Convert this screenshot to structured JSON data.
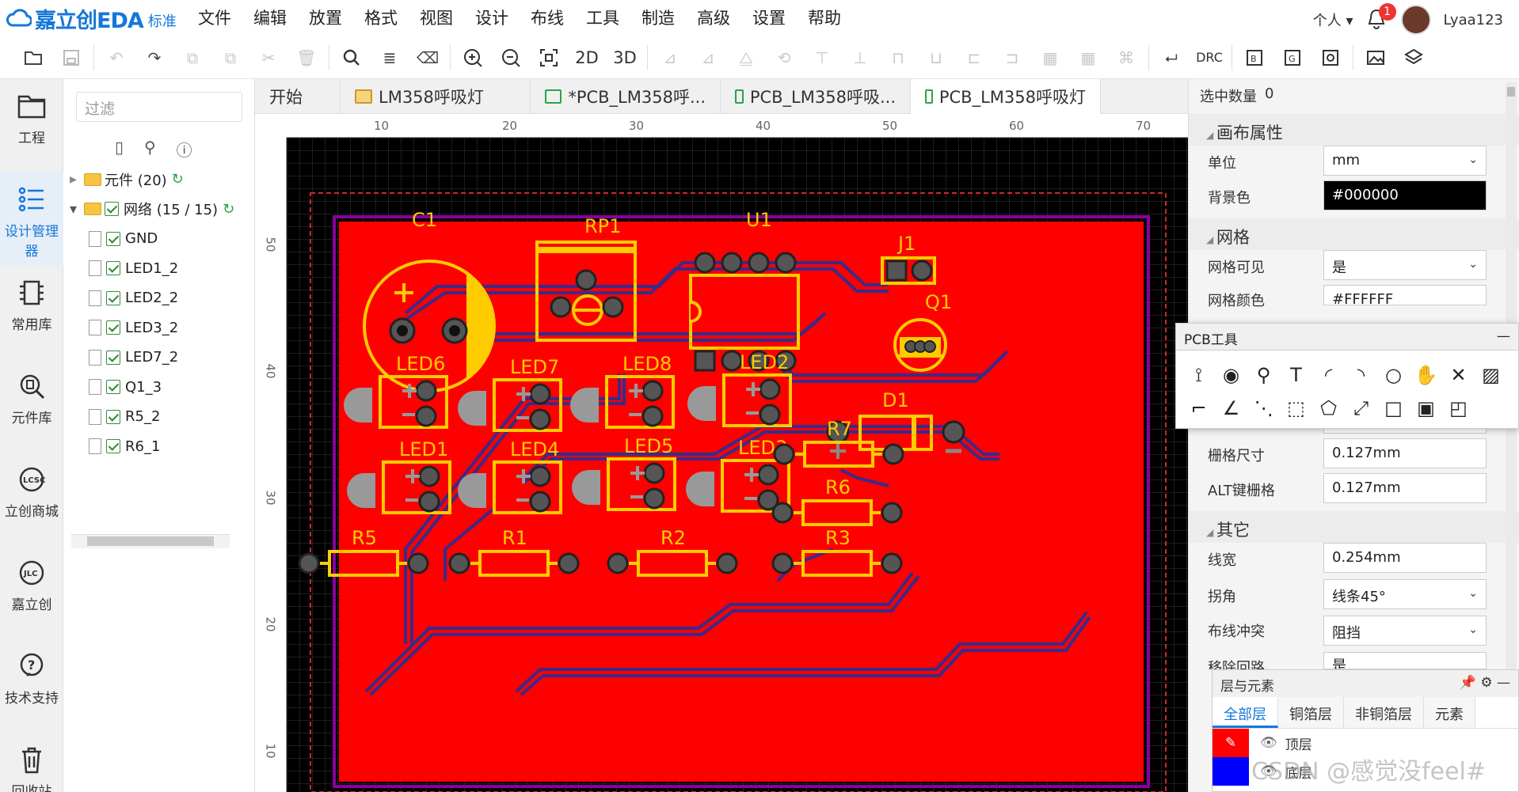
{
  "app": {
    "logo_text": "嘉立创EDA",
    "edition": "标准"
  },
  "menu": [
    "文件",
    "编辑",
    "放置",
    "格式",
    "视图",
    "设计",
    "布线",
    "工具",
    "制造",
    "高级",
    "设置",
    "帮助"
  ],
  "user": {
    "scope": "个人",
    "notifications": "1",
    "name": "Lyaa123"
  },
  "toolbar": {
    "btn_2d": "2D",
    "btn_3d": "3D",
    "btn_drc": "DRC"
  },
  "leftnav": [
    {
      "label": "工程",
      "icon": "folder-icon"
    },
    {
      "label": "设计管理器",
      "icon": "list-icon"
    },
    {
      "label": "常用库",
      "icon": "chip-icon"
    },
    {
      "label": "元件库",
      "icon": "search-chip-icon"
    },
    {
      "label": "立创商城",
      "icon": "lcsc-icon"
    },
    {
      "label": "嘉立创",
      "icon": "jlc-icon"
    },
    {
      "label": "技术支持",
      "icon": "help-icon"
    },
    {
      "label": "回收站",
      "icon": "trash-icon"
    }
  ],
  "tree": {
    "filter_placeholder": "过滤",
    "components": "元件 (20)",
    "nets": "网络 (15 / 15)",
    "net_items": [
      "GND",
      "LED1_2",
      "LED2_2",
      "LED3_2",
      "LED7_2",
      "Q1_3",
      "R5_2",
      "R6_1"
    ]
  },
  "tabs": [
    "开始",
    "LM358呼吸灯",
    "*PCB_LM358呼...",
    "PCB_LM358呼吸...",
    "PCB_LM358呼吸灯"
  ],
  "ruler": {
    "top": [
      "10",
      "20",
      "30",
      "40",
      "50",
      "60",
      "70"
    ],
    "left": [
      "50",
      "40",
      "30",
      "20",
      "10"
    ]
  },
  "pcb": {
    "components": [
      "C1",
      "RP1",
      "U1",
      "J1",
      "Q1",
      "D1",
      "LED6",
      "LED7",
      "LED8",
      "LED2",
      "LED1",
      "LED4",
      "LED5",
      "LED3",
      "R7",
      "R6",
      "R5",
      "R1",
      "R2",
      "R3"
    ],
    "colors": {
      "board": "#ff0000",
      "silk": "#ffcc00",
      "track": "#3a2a8a",
      "outline": "#800080"
    }
  },
  "props": {
    "selection_label": "选中数量",
    "selection_value": "0",
    "canvas_section": "画布属性",
    "unit_label": "单位",
    "unit_value": "mm",
    "bg_label": "背景色",
    "bg_value": "#000000",
    "grid_section": "网格",
    "grid_visible_label": "网格可见",
    "grid_visible_value": "是",
    "grid_color_label": "网格颜色",
    "grid_color_value": "#FFFFFF",
    "grid_size_label": "栅格尺寸",
    "grid_size_value": "0.127mm",
    "alt_grid_label": "ALT键栅格",
    "alt_grid_value": "0.127mm",
    "other_section": "其它",
    "width_label": "线宽",
    "width_value": "0.254mm",
    "corner_label": "拐角",
    "corner_value": "线条45°",
    "conflict_label": "布线冲突",
    "conflict_value": "阻挡",
    "loop_label": "移除回路",
    "loop_value": "是"
  },
  "pcbtool": {
    "title": "PCB工具"
  },
  "layers": {
    "title": "层与元素",
    "tabs": [
      "全部层",
      "铜箔层",
      "非铜箔层",
      "元素"
    ],
    "items": [
      {
        "name": "顶层",
        "color": "#ff0000"
      },
      {
        "name": "底层",
        "color": "#0000ff"
      }
    ]
  },
  "watermark": "CSDN @感觉没feel#"
}
